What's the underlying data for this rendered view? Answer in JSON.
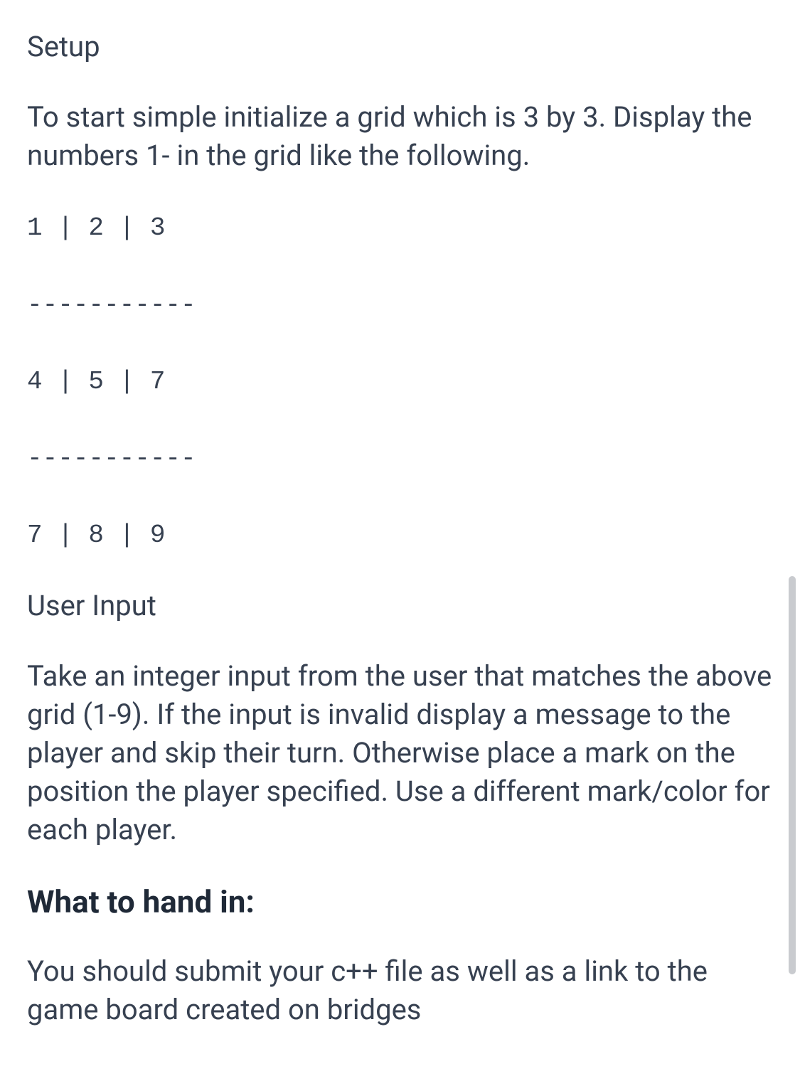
{
  "sections": {
    "setup": {
      "heading": "Setup",
      "body": "To start simple initialize a grid which is 3 by 3. Display the numbers 1-  in the grid like the following."
    },
    "grid_example": "1 | 2 | 3\n\n-----------\n\n4 | 5 | 7\n\n-----------\n\n7 | 8 | 9",
    "user_input": {
      "heading": "User Input",
      "body": "Take an integer input from the user that matches the above grid (1-9). If the input is invalid display a message to the player and skip their turn. Otherwise place a mark on the position the player specified. Use a different mark/color for each player."
    },
    "handin": {
      "heading": "What to hand in:",
      "body": "You should submit your c++ file as well as a link to the game board created on bridges"
    }
  }
}
